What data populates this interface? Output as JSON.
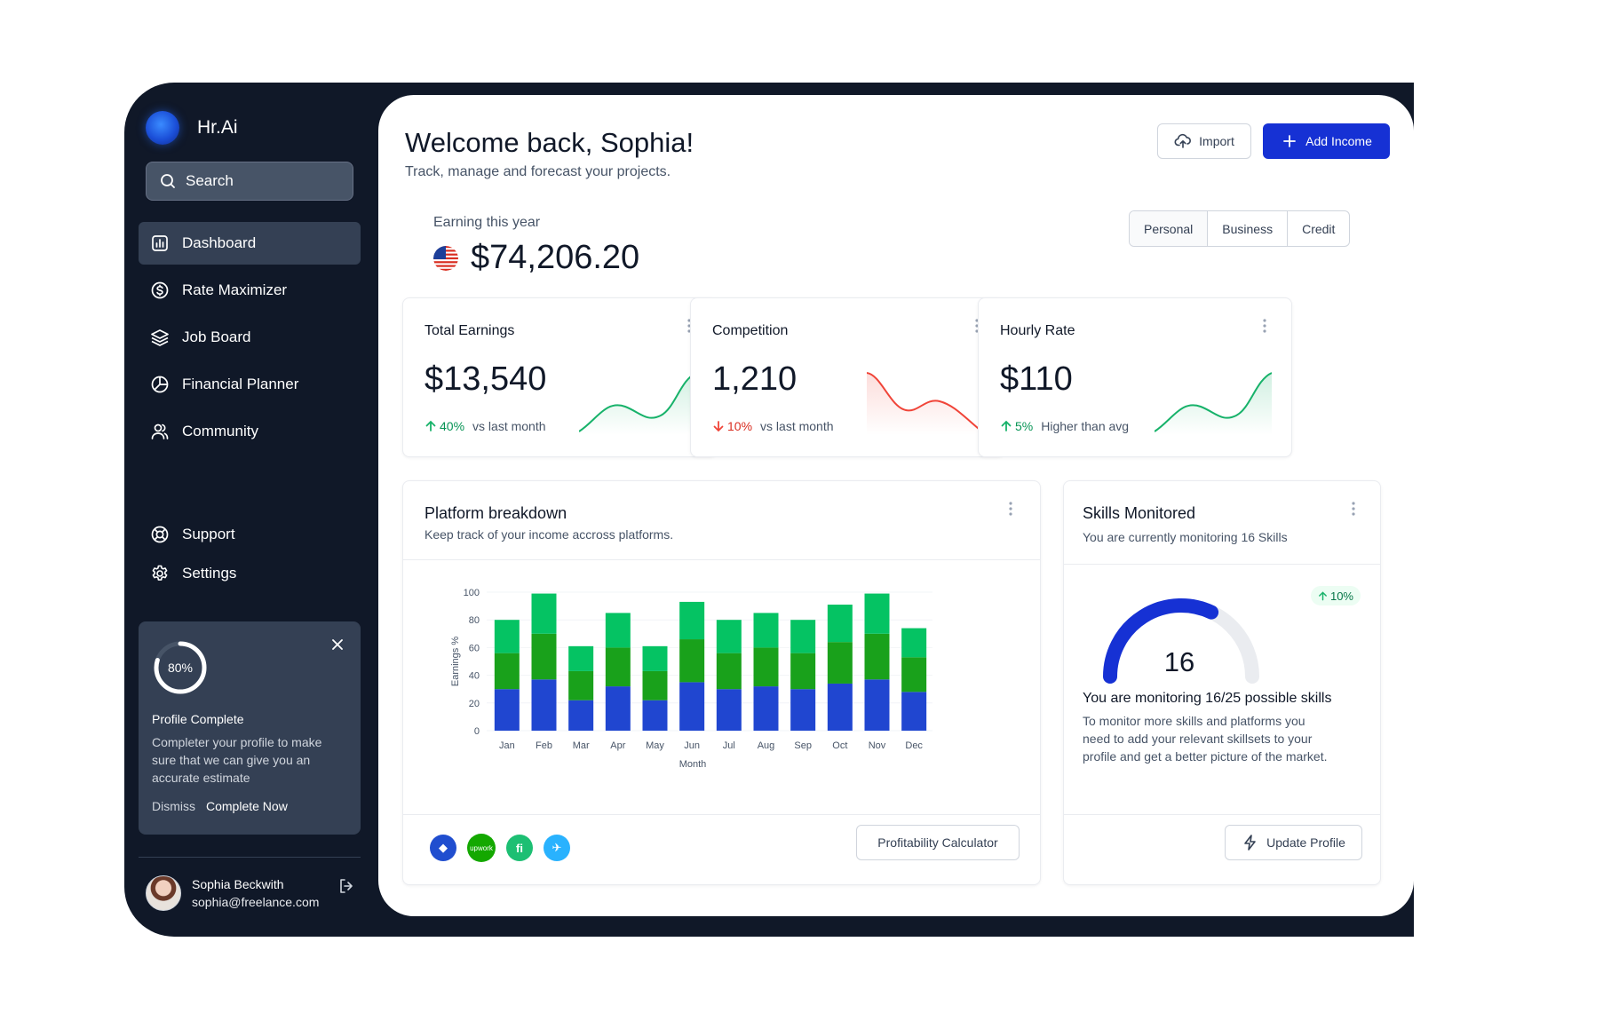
{
  "app": {
    "name": "Hr.Ai"
  },
  "search": {
    "placeholder": "Search"
  },
  "nav": {
    "items": [
      {
        "label": "Dashboard",
        "icon": "bar-chart-icon",
        "active": true
      },
      {
        "label": "Rate Maximizer",
        "icon": "dollar-circle-icon"
      },
      {
        "label": "Job Board",
        "icon": "layers-icon"
      },
      {
        "label": "Financial Planner",
        "icon": "pie-chart-icon"
      },
      {
        "label": "Community",
        "icon": "users-icon"
      }
    ],
    "bottom": [
      {
        "label": "Support",
        "icon": "life-buoy-icon"
      },
      {
        "label": "Settings",
        "icon": "gear-icon"
      }
    ]
  },
  "profile_card": {
    "progress": "80%",
    "progress_value": 0.8,
    "title": "Profile Complete",
    "text": "Completer your profile to make sure that we can give you an accurate estimate",
    "dismiss": "Dismiss",
    "complete": "Complete Now"
  },
  "user": {
    "name": "Sophia Beckwith",
    "email": "sophia@freelance.com"
  },
  "header": {
    "title": "Welcome back, Sophia!",
    "subtitle": "Track, manage and forecast your projects.",
    "import_label": "Import",
    "add_label": "Add Income"
  },
  "earning": {
    "label": "Earning this year",
    "value": "$74,206.20"
  },
  "segments": [
    "Personal",
    "Business",
    "Credit"
  ],
  "kpis": [
    {
      "title": "Total Earnings",
      "value": "$13,540",
      "pct": "40%",
      "context": "vs last month",
      "trend": "up",
      "color": "#17b26a"
    },
    {
      "title": "Competition",
      "value": "1,210",
      "pct": "10%",
      "context": "vs last month",
      "trend": "down",
      "color": "#f04438"
    },
    {
      "title": "Hourly Rate",
      "value": "$110",
      "pct": "5%",
      "context": "Higher than avg",
      "trend": "up",
      "color": "#17b26a"
    }
  ],
  "platform": {
    "title": "Platform breakdown",
    "subtitle": "Keep track of your income accross platforms.",
    "calc_label": "Profitability Calculator"
  },
  "chart_data": {
    "type": "bar",
    "stacked": true,
    "categories": [
      "Jan",
      "Feb",
      "Mar",
      "Apr",
      "May",
      "Jun",
      "Jul",
      "Aug",
      "Sep",
      "Oct",
      "Nov",
      "Dec"
    ],
    "series": [
      {
        "color": "#2046d0",
        "values": [
          30,
          37,
          22,
          32,
          22,
          35,
          30,
          32,
          30,
          34,
          37,
          28
        ]
      },
      {
        "color": "#19a11b",
        "values": [
          26,
          33,
          21,
          28,
          21,
          31,
          26,
          28,
          26,
          30,
          33,
          25
        ]
      },
      {
        "color": "#05c363",
        "values": [
          24,
          29,
          18,
          25,
          18,
          27,
          24,
          25,
          24,
          27,
          29,
          21
        ]
      }
    ],
    "ylabel": "Earnings %",
    "xlabel": "Month",
    "ylim": [
      0,
      100
    ],
    "yticks": [
      0,
      20,
      40,
      60,
      80,
      100
    ],
    "grid": true
  },
  "platform_icons": [
    {
      "name": "toptal",
      "color": "#204ecf",
      "glyph": "◆"
    },
    {
      "name": "upwork",
      "color": "#14a800",
      "glyph": "upwork"
    },
    {
      "name": "fiverr",
      "color": "#1dbf73",
      "glyph": "fi"
    },
    {
      "name": "freelancer",
      "color": "#29b2fe",
      "glyph": "✈"
    }
  ],
  "skills": {
    "title": "Skills Monitored",
    "subtitle": "You are currently monitoring 16 Skills",
    "count": "16",
    "monitored": 16,
    "total": 25,
    "badge": "10%",
    "headline": "You are monitoring 16/25 possible skills",
    "text": "To monitor more skills and platforms you need to add your relevant skillsets to your profile and get a better picture of the market.",
    "update_label": "Update Profile"
  }
}
